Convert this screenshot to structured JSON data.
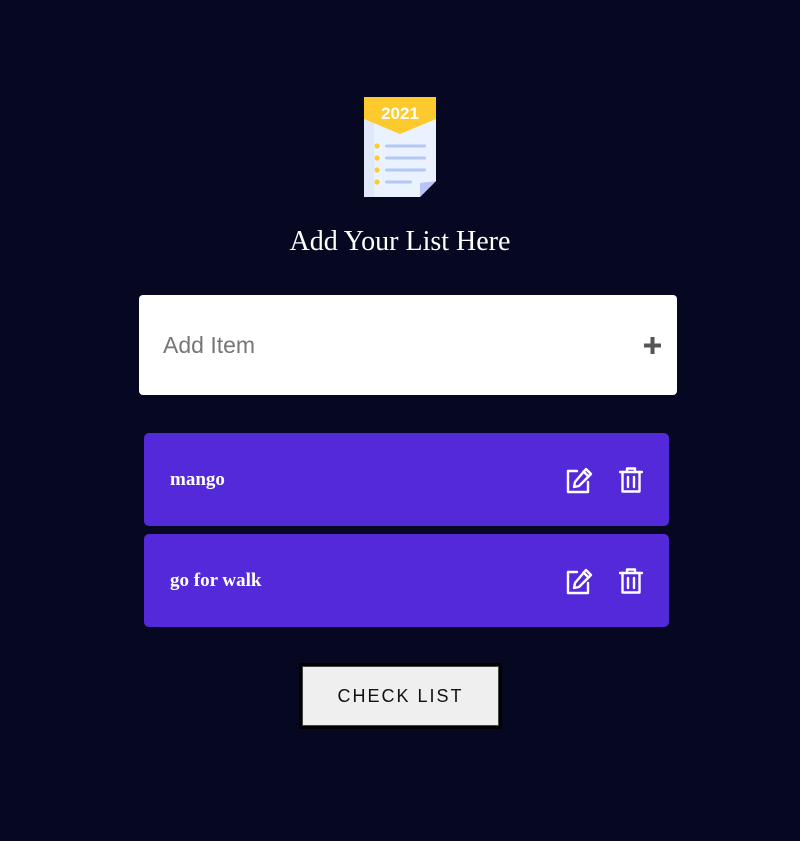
{
  "logo": {
    "year": "2021",
    "icon": "checklist-icon"
  },
  "heading": "Add Your List Here",
  "add_item": {
    "placeholder": "Add Item",
    "value": "",
    "button_icon": "plus-icon"
  },
  "items": [
    {
      "label": "mango"
    },
    {
      "label": "go for walk"
    }
  ],
  "check_button": "CHECK LIST",
  "colors": {
    "background": "#060822",
    "item_bg": "#5429da",
    "logo_accent": "#fcca2c"
  }
}
